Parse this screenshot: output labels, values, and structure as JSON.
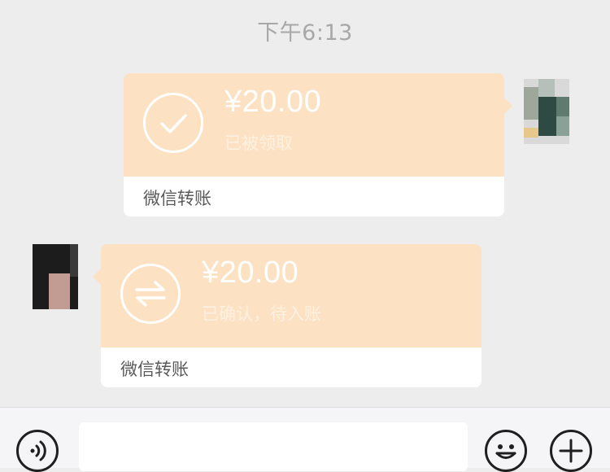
{
  "chat": {
    "timestamp": "下午6:13",
    "messages": [
      {
        "side": "right",
        "amount": "¥20.00",
        "status": "已被领取",
        "label": "微信转账",
        "icon": "check-icon"
      },
      {
        "side": "left",
        "amount": "¥20.00",
        "status": "已确认，待入账",
        "label": "微信转账",
        "icon": "transfer-arrows-icon"
      }
    ]
  },
  "colors": {
    "card_accent": "#fce1c3",
    "background": "#ededed"
  },
  "input_bar": {
    "voice_icon": "voice-icon",
    "emoji_icon": "emoji-icon",
    "plus_icon": "plus-icon"
  }
}
